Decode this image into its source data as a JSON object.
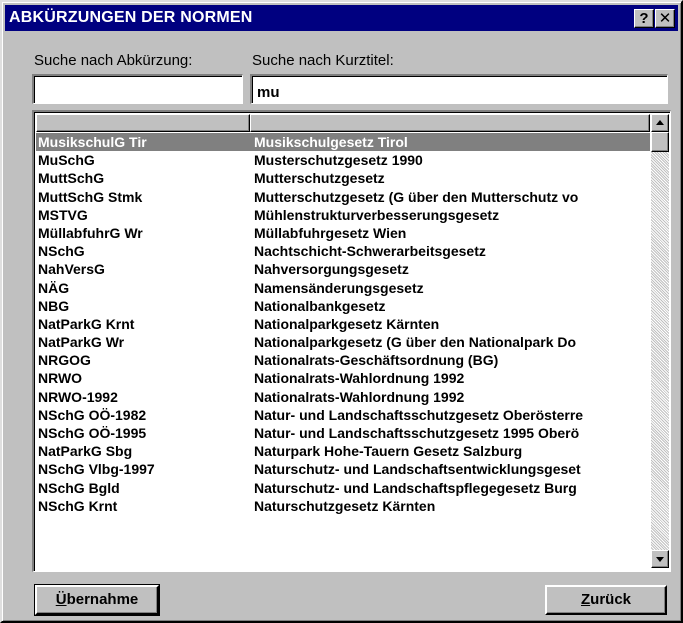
{
  "window": {
    "title": "ABKÜRZUNGEN DER NORMEN",
    "help_label": "?",
    "close_label": "✕"
  },
  "search": {
    "abbr_label": "Suche nach Abkürzung:",
    "title_label": "Suche nach Kurztitel:",
    "abbr_value": "",
    "title_value": "mu"
  },
  "list": {
    "columns": [
      "",
      ""
    ],
    "selected_index": 0,
    "rows": [
      {
        "abbr": "MusikschulG Tir",
        "title": "Musikschulgesetz Tirol"
      },
      {
        "abbr": "MuSchG",
        "title": "Musterschutzgesetz 1990"
      },
      {
        "abbr": "MuttSchG",
        "title": "Mutterschutzgesetz"
      },
      {
        "abbr": "MuttSchG Stmk",
        "title": "Mutterschutzgesetz (G über den Mutterschutz vo"
      },
      {
        "abbr": "MSTVG",
        "title": "Mühlenstrukturverbesserungsgesetz"
      },
      {
        "abbr": "MüllabfuhrG Wr",
        "title": "Müllabfuhrgesetz Wien"
      },
      {
        "abbr": "NSchG",
        "title": "Nachtschicht-Schwerarbeitsgesetz"
      },
      {
        "abbr": "NahVersG",
        "title": "Nahversorgungsgesetz"
      },
      {
        "abbr": "NÄG",
        "title": "Namensänderungsgesetz"
      },
      {
        "abbr": "NBG",
        "title": "Nationalbankgesetz"
      },
      {
        "abbr": "NatParkG Krnt",
        "title": "Nationalparkgesetz Kärnten"
      },
      {
        "abbr": "NatParkG Wr",
        "title": "Nationalparkgesetz (G über den Nationalpark Do"
      },
      {
        "abbr": "NRGOG",
        "title": "Nationalrats-Geschäftsordnung (BG)"
      },
      {
        "abbr": "NRWO",
        "title": "Nationalrats-Wahlordnung 1992"
      },
      {
        "abbr": "NRWO-1992",
        "title": "Nationalrats-Wahlordnung 1992"
      },
      {
        "abbr": "NSchG OÖ-1982",
        "title": "Natur- und Landschaftsschutzgesetz Oberösterre"
      },
      {
        "abbr": "NSchG OÖ-1995",
        "title": "Natur- und Landschaftsschutzgesetz 1995 Oberö"
      },
      {
        "abbr": "NatParkG Sbg",
        "title": "Naturpark Hohe-Tauern Gesetz Salzburg"
      },
      {
        "abbr": "NSchG Vlbg-1997",
        "title": "Naturschutz- und Landschaftsentwicklungsgeset"
      },
      {
        "abbr": "NSchG Bgld",
        "title": "Naturschutz- und Landschaftspflegegesetz Burg"
      },
      {
        "abbr": "NSchG Krnt",
        "title": "Naturschutzgesetz Kärnten"
      }
    ]
  },
  "buttons": {
    "take_accel": "Ü",
    "take_rest": "bernahme",
    "back_accel": "Z",
    "back_rest": "urück"
  }
}
